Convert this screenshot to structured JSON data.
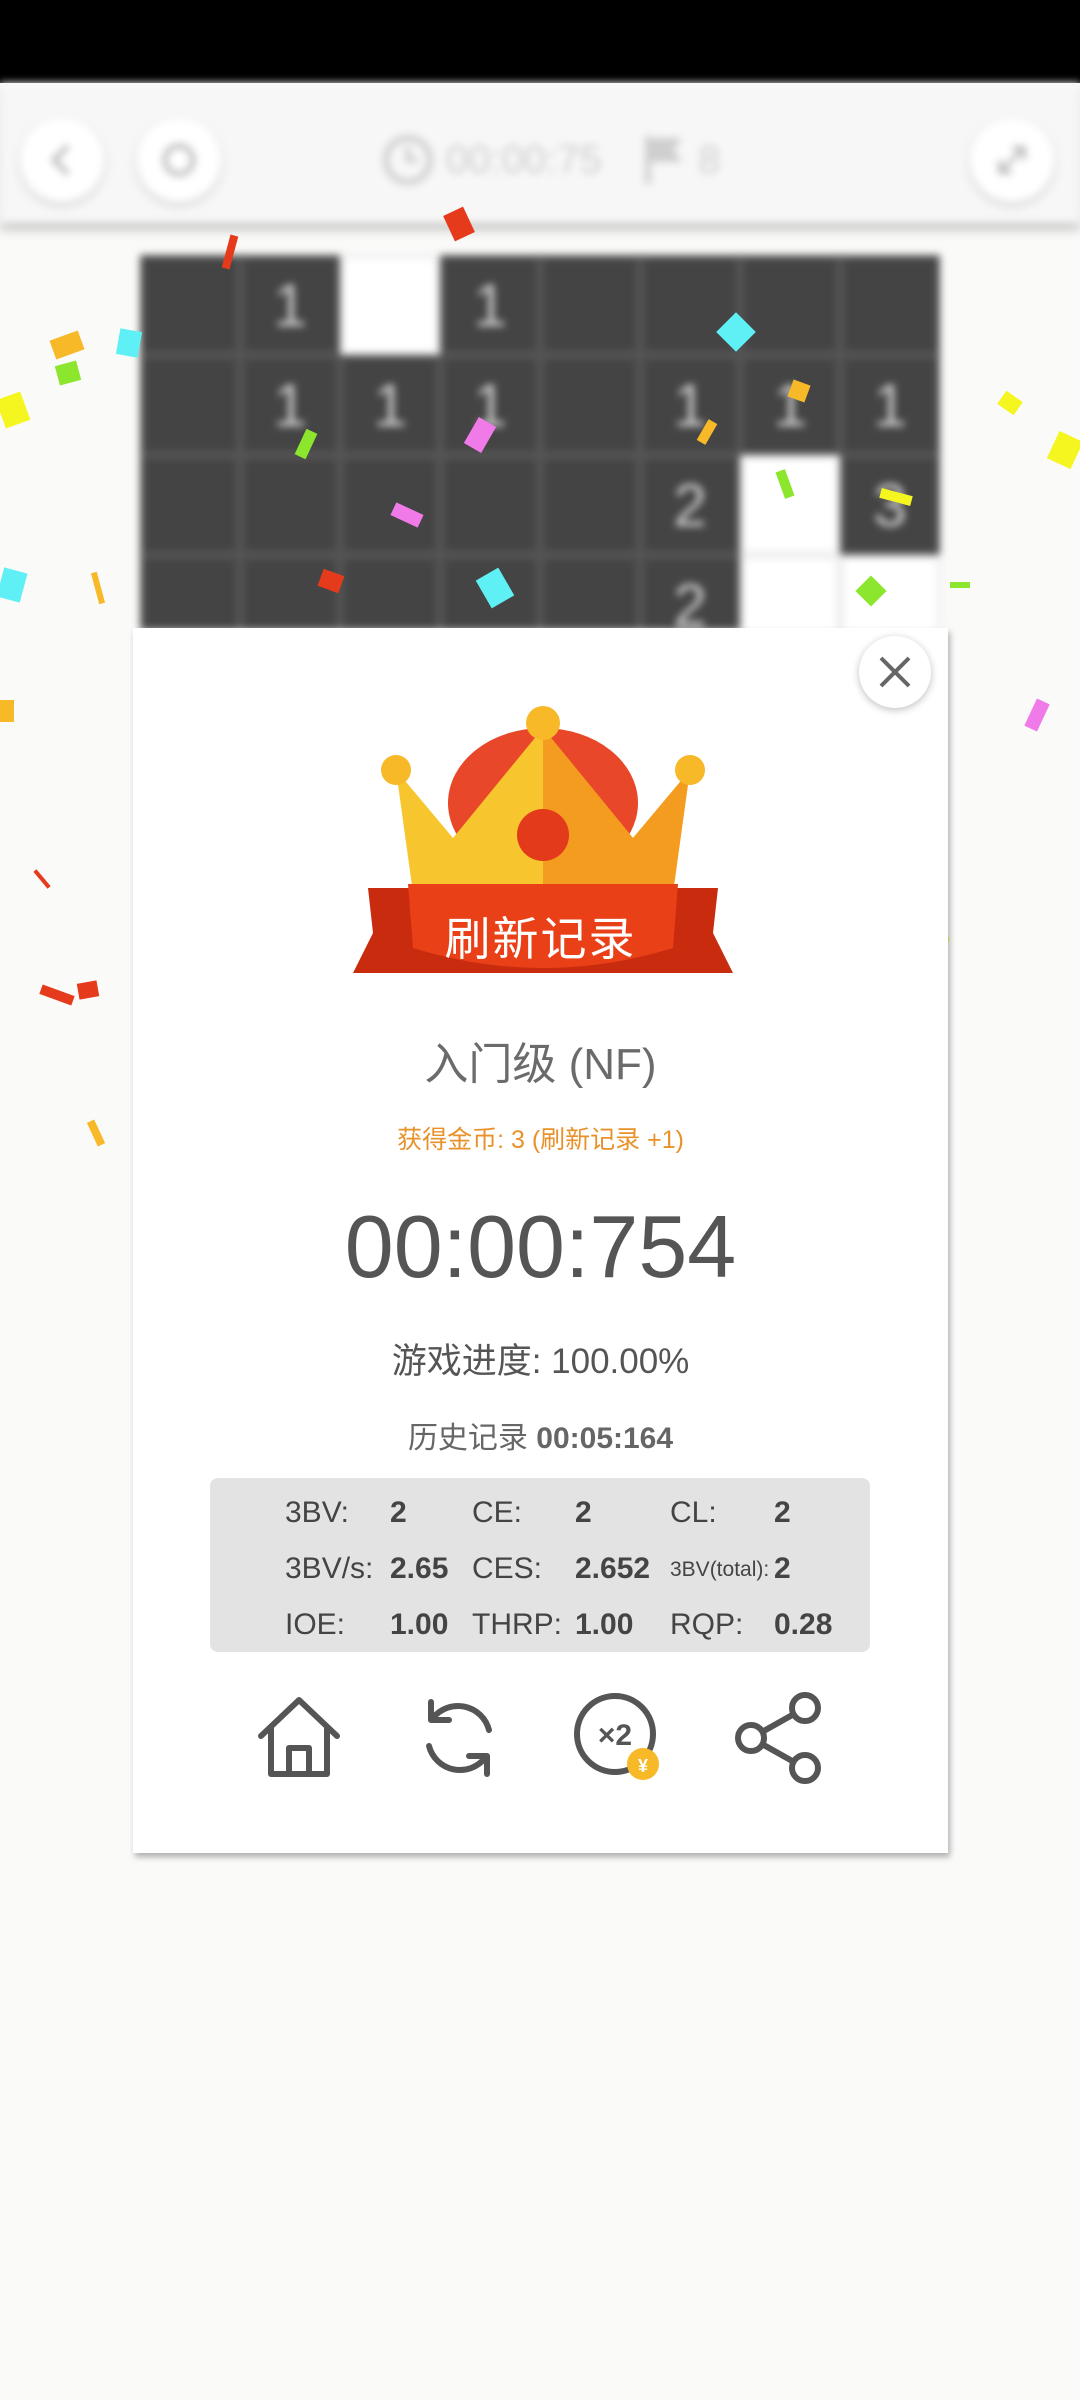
{
  "toolbar": {
    "timer": "00:00:75",
    "flags": "8"
  },
  "board": {
    "rows": [
      [
        "",
        "1",
        "open",
        "1",
        "",
        "",
        "",
        ""
      ],
      [
        "",
        "1",
        "1",
        "1",
        "",
        "1",
        "1",
        "1"
      ],
      [
        "",
        "",
        "",
        "",
        "",
        "2",
        "open",
        "3"
      ],
      [
        "",
        "",
        "",
        "",
        "",
        "2",
        "open",
        "open"
      ]
    ]
  },
  "dialog": {
    "ribbon_title": "刷新记录",
    "level": "入门级 (NF)",
    "coins_text": "获得金币: 3 (刷新记录 +1)",
    "time": "00:00:754",
    "progress": "游戏进度: 100.00%",
    "history_label": "历史记录",
    "history_value": "00:05:164",
    "stats": {
      "bv_label": "3BV:",
      "bv_value": "2",
      "ce_label": "CE:",
      "ce_value": "2",
      "cl_label": "CL:",
      "cl_value": "2",
      "bvs_label": "3BV/s:",
      "bvs_value": "2.65",
      "ces_label": "CES:",
      "ces_value": "2.652",
      "bvtotal_label": "3BV(total):",
      "bvtotal_value": "2",
      "ioe_label": "IOE:",
      "ioe_value": "1.00",
      "thrp_label": "THRP:",
      "thrp_value": "1.00",
      "rqp_label": "RQP:",
      "rqp_value": "0.28"
    },
    "actions": {
      "double_badge": "×2",
      "coin_symbol": "¥"
    }
  },
  "colors": {
    "accent_orange": "#e8922b",
    "ribbon_red": "#e23a1a",
    "crown_gold": "#f7b928",
    "stats_bg": "#e3e3e3",
    "text_gray": "#555555"
  },
  "icons": [
    "back-icon",
    "restart-icon",
    "clock-icon",
    "flag-icon",
    "expand-icon",
    "close-icon",
    "crown-icon",
    "home-icon",
    "replay-icon",
    "double-coin-icon",
    "share-icon"
  ]
}
